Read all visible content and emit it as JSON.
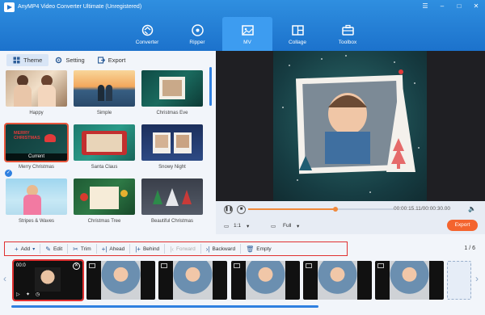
{
  "window": {
    "title": "AnyMP4 Video Converter Ultimate (Unregistered)"
  },
  "nav": [
    {
      "label": "Converter",
      "icon": "converter-icon"
    },
    {
      "label": "Ripper",
      "icon": "ripper-icon"
    },
    {
      "label": "MV",
      "icon": "mv-icon",
      "active": true
    },
    {
      "label": "Collage",
      "icon": "collage-icon"
    },
    {
      "label": "Toolbox",
      "icon": "toolbox-icon"
    }
  ],
  "tabs": [
    {
      "label": "Theme",
      "active": true
    },
    {
      "label": "Setting"
    },
    {
      "label": "Export"
    }
  ],
  "themes": [
    {
      "label": "Happy"
    },
    {
      "label": "Simple"
    },
    {
      "label": "Christmas Eve"
    },
    {
      "label": "Merry Christmas",
      "current": true,
      "badge": "Current",
      "thumb_text": "MERRY CHRISTMAS"
    },
    {
      "label": "Santa Claus"
    },
    {
      "label": "Snowy Night"
    },
    {
      "label": "Stripes & Waves"
    },
    {
      "label": "Christmas Tree"
    },
    {
      "label": "Beautiful Christmas"
    }
  ],
  "player": {
    "time": "00:00:15.11/00:00:30.00",
    "progress": 0.6,
    "ratio": "1:1",
    "view": "Full",
    "export_label": "Export"
  },
  "toolbar": {
    "add": "Add",
    "edit": "Edit",
    "trim": "Trim",
    "ahead": "Ahead",
    "behind": "Behind",
    "forward": "Forward",
    "backward": "Backward",
    "empty": "Empty"
  },
  "timeline": {
    "page": "1 / 6",
    "first_clip_time": "00:0"
  },
  "colors": {
    "header": "#1c72cc",
    "accent": "#f4642e",
    "selection": "#e03030"
  }
}
